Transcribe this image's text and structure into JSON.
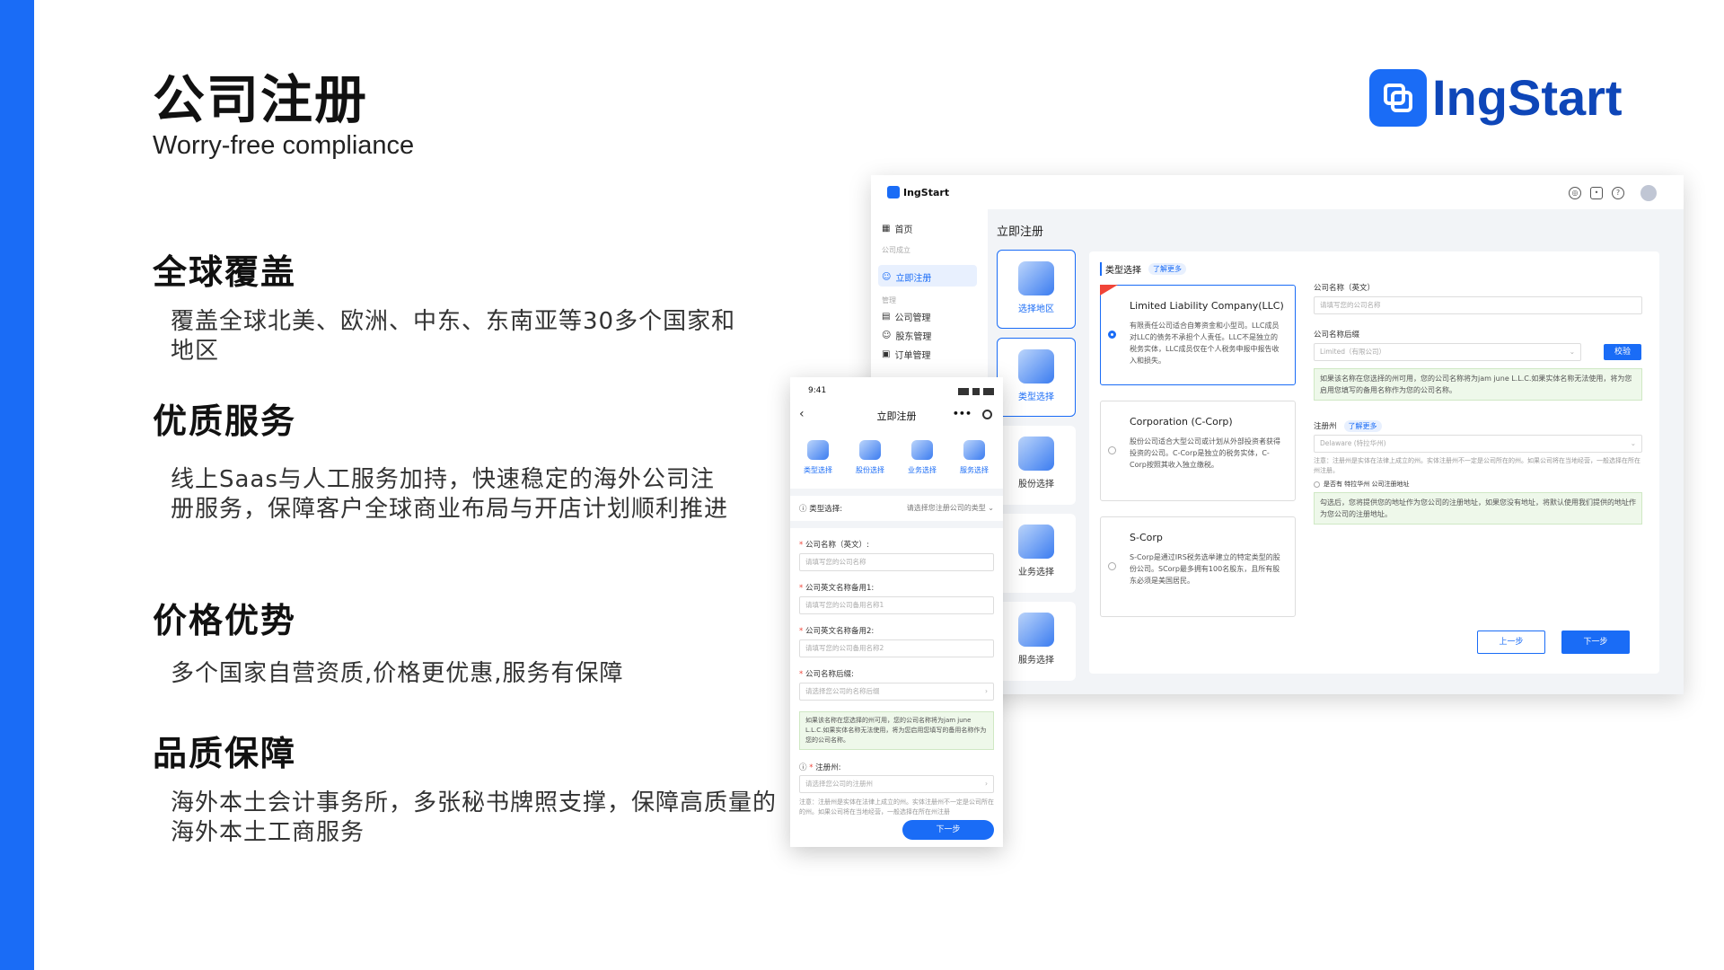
{
  "slide": {
    "title": "公司注册",
    "subtitle": "Worry-free compliance",
    "brand": "IngStart",
    "accent_color": "#1a6cf6"
  },
  "features": [
    {
      "title": "全球覆盖",
      "desc": "覆盖全球北美、欧洲、中东、东南亚等30多个国家和地区"
    },
    {
      "title": "优质服务",
      "desc": "线上Saas与人工服务加持，快速稳定的海外公司注册服务，保障客户全球商业布局与开店计划顺利推进"
    },
    {
      "title": "价格优势",
      "desc": "多个国家自营资质,价格更优惠,服务有保障"
    },
    {
      "title": "品质保障",
      "desc": "海外本土会计事务所，多张秘书牌照支撑，保障高质量的海外本土工商服务"
    }
  ],
  "desktop": {
    "brand": "IngStart",
    "nav": {
      "home": "首页",
      "group1": "公司成立",
      "register": "立即注册",
      "group2": "管理",
      "company": "公司管理",
      "shareholder": "股东管理",
      "orders": "订单管理"
    },
    "page_title": "立即注册",
    "steps": [
      "选择地区",
      "类型选择",
      "股份选择",
      "业务选择",
      "服务选择"
    ],
    "card_title": "类型选择",
    "learn_more": "了解更多",
    "options": [
      {
        "name": "Limited Liability Company(LLC)",
        "desc": "有限责任公司适合自筹资金和小型司。LLC成员对LLC的债务不承担个人责任。LLC不是独立的税务实体，LLC成员仅在个人税务申报中报告收入和损失。"
      },
      {
        "name": "Corporation (C-Corp)",
        "desc": "股份公司适合大型公司或计划从外部投资者获得投资的公司。C-Corp是独立的税务实体，C-Corp按照其收入独立缴税。"
      },
      {
        "name": "S-Corp",
        "desc": "S-Corp是通过IRS税务选举建立的特定类型的股份公司。SCorp最多拥有100名股东，且所有股东必须是美国居民。"
      }
    ],
    "form": {
      "name_label": "公司名称（英文）",
      "name_placeholder": "请填写您的公司名称",
      "suffix_label": "公司名称后缀",
      "suffix_value": "Limited（有限公司）",
      "check_button": "校验",
      "name_note": "如果该名称在您选择的州可用，您的公司名称将为jam june L.L.C.如果实体名称无法使用，将为您启用您填写的备用名称作为您的公司名称。",
      "state_label": "注册州",
      "state_value": "Delaware (特拉华州)",
      "state_tip": "注意：注册州是实体在法律上成立的州。实体注册州不一定是公司所在的州。如果公司将在当地经营，一般选择在所在州注册。",
      "checkbox_label": "是否有 特拉华州 公司注册地址",
      "address_note": "勾选后，您将提供您的地址作为您公司的注册地址，如果您没有地址，将默认使用我们提供的地址作为您公司的注册地址。"
    },
    "prev_button": "上一步",
    "next_button": "下一步"
  },
  "mobile": {
    "time": "9:41",
    "title": "立即注册",
    "steps": [
      "类型选择",
      "股份选择",
      "业务选择",
      "服务选择"
    ],
    "type_label": "类型选择:",
    "type_value": "请选择您注册公司的类型",
    "fields": [
      {
        "label": "公司名称（英文）:",
        "placeholder": "请填写您的公司名称"
      },
      {
        "label": "公司英文名称备用1:",
        "placeholder": "请填写您的公司备用名称1"
      },
      {
        "label": "公司英文名称备用2:",
        "placeholder": "请填写您的公司备用名称2"
      },
      {
        "label": "公司名称后缀:",
        "placeholder": "请选择您公司的名称后缀"
      }
    ],
    "note": "如果该名称在您选择的州可用，您的公司名称将为jam june L.L.C.如果实体名称无法使用，将为您启用您填写的备用名称作为您的公司名称。",
    "state_label": "注册州:",
    "state_placeholder": "请选择您公司的注册州",
    "state_tip": "注意：注册州是实体在法律上成立的州。实体注册州不一定是公司所在的州。如果公司将在当地经营，一般选择在所在州注册",
    "next_button": "下一步"
  }
}
